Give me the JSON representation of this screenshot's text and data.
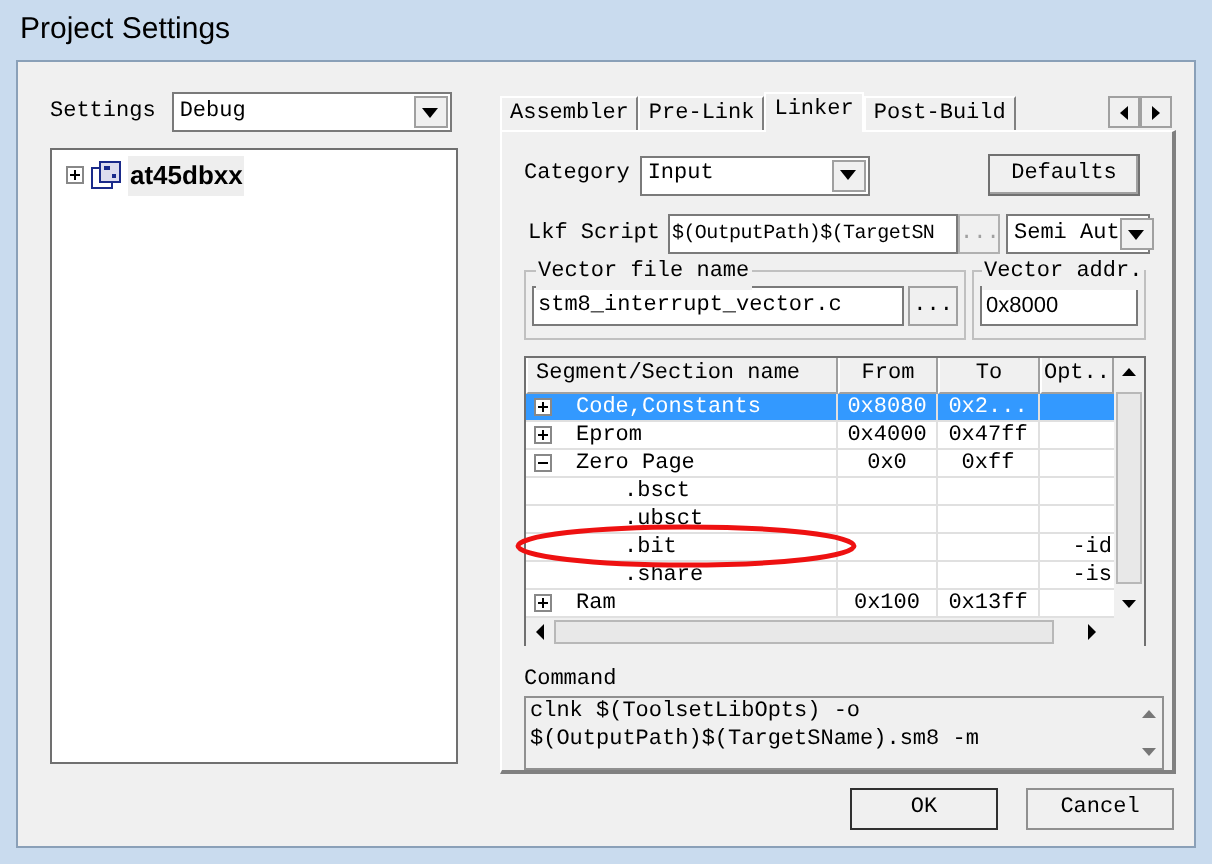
{
  "window": {
    "title": "Project Settings"
  },
  "settings": {
    "label": "Settings",
    "value": "Debug"
  },
  "tree": [
    {
      "label": "at45dbxx",
      "expanded": false
    }
  ],
  "tabs": [
    {
      "label": "Assembler",
      "selected": false
    },
    {
      "label": "Pre-Link",
      "selected": false
    },
    {
      "label": "Linker",
      "selected": true
    },
    {
      "label": "Post-Build",
      "selected": false
    }
  ],
  "category": {
    "label": "Category",
    "value": "Input"
  },
  "defaults_button": "Defaults",
  "lkf_script": {
    "label": "Lkf Script",
    "value": "$(OutputPath)$(TargetSN",
    "browse": "...",
    "mode": "Semi Aut"
  },
  "vector_file": {
    "legend": "Vector file name",
    "value": "stm8_interrupt_vector.c",
    "browse": "..."
  },
  "vector_addr": {
    "legend": "Vector addr.",
    "value": "0x8000"
  },
  "table": {
    "columns": [
      "Segment/Section name",
      "From",
      "To",
      "Opt.."
    ],
    "rows": [
      {
        "name": "Code,Constants",
        "from": "0x8080",
        "to": "0x2...",
        "selected": true,
        "expanded": false
      },
      {
        "name": "Eprom",
        "from": "0x4000",
        "to": "0x47ff",
        "selected": false,
        "expanded": false
      },
      {
        "name": "Zero Page",
        "from": "0x0",
        "to": "0xff",
        "selected": false,
        "expanded": true,
        "children": [
          {
            "name": ".bsct",
            "selected": false
          },
          {
            "name": ".ubsct",
            "selected": false
          },
          {
            "name": ".bit",
            "opt": "-id",
            "selected": false
          },
          {
            "name": ".share",
            "opt": "-is",
            "selected": false
          }
        ]
      },
      {
        "name": "Ram",
        "from": "0x100",
        "to": "0x13ff",
        "selected": false,
        "expanded": false
      }
    ]
  },
  "command": {
    "label": "Command",
    "lines": [
      "clnk $(ToolsetLibOpts) -o",
      "$(OutputPath)$(TargetSName).sm8 -m"
    ]
  },
  "buttons": [
    "OK",
    "Cancel"
  ]
}
